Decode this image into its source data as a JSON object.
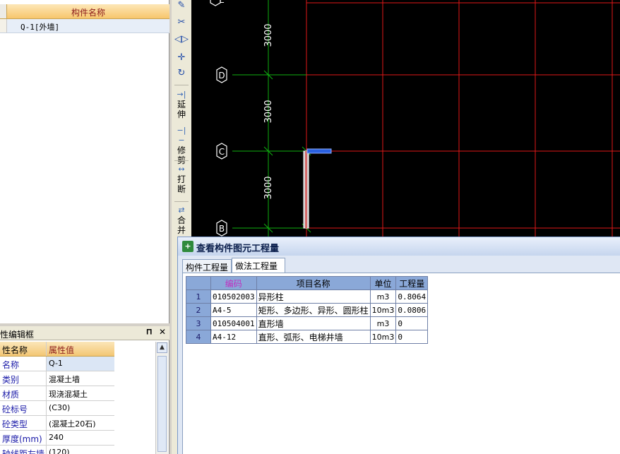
{
  "component_list": {
    "header": "构件名称",
    "items": [
      {
        "name": "Q-1[外墙]"
      }
    ]
  },
  "property_panel": {
    "title": "性编辑框",
    "pin_icon": "pin-icon",
    "close_icon": "close-icon",
    "header_name": "性名称",
    "header_value": "属性值",
    "rows": [
      {
        "name": "名称",
        "value": "Q-1"
      },
      {
        "name": "类别",
        "value": "混凝土墙"
      },
      {
        "name": "材质",
        "value": "现浇混凝土"
      },
      {
        "name": "砼标号",
        "value": "(C30)"
      },
      {
        "name": "砼类型",
        "value": "(混凝土20石)"
      },
      {
        "name": "厚度(mm)",
        "value": "240"
      },
      {
        "name": "轴线距左墙",
        "value": "(120)"
      }
    ]
  },
  "toolbar": {
    "icons": [
      "brush-icon",
      "copy-icon",
      "mirror-icon",
      "move-icon",
      "rotate-icon"
    ],
    "extend": {
      "icon": "extend-icon",
      "label": "延伸"
    },
    "trim": {
      "icon": "trim-icon",
      "label": "修剪"
    },
    "break": {
      "icon": "break-icon",
      "label": "打断"
    },
    "merge": {
      "icon": "merge-icon",
      "label": "合并"
    }
  },
  "cad": {
    "axes": [
      "E",
      "D",
      "C",
      "B"
    ],
    "dimensions": [
      "3000",
      "3000",
      "3000"
    ]
  },
  "dialog": {
    "title": "查看构件图元工程量",
    "tabs": [
      "构件工程量",
      "做法工程量"
    ],
    "active_tab": 1,
    "table": {
      "headers": [
        "编码",
        "项目名称",
        "单位",
        "工程量"
      ],
      "rows": [
        {
          "no": "1",
          "code": "010502003",
          "name": "异形柱",
          "unit": "m3",
          "qty": "0.8064"
        },
        {
          "no": "2",
          "code": "A4-5",
          "name": "矩形、多边形、异形、圆形柱",
          "unit": "10m3",
          "qty": "0.0806"
        },
        {
          "no": "3",
          "code": "010504001",
          "name": "直形墙",
          "unit": "m3",
          "qty": "0"
        },
        {
          "no": "4",
          "code": "A4-12",
          "name": "直形、弧形、电梯井墙",
          "unit": "10m3",
          "qty": "0"
        }
      ]
    }
  },
  "colors": {
    "grid_red": "#e01818",
    "axis_green": "#10b010",
    "wall_blue": "#2a60e0",
    "header_orange": "#f7c66c"
  }
}
